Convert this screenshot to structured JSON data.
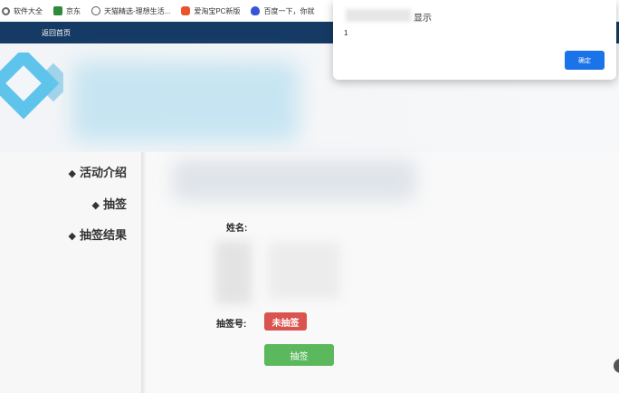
{
  "bookmarks": [
    {
      "label": "软件大全",
      "icon": "gear-icon"
    },
    {
      "label": "京东",
      "icon": "jd-icon"
    },
    {
      "label": "天猫精选-理想生活...",
      "icon": "globe-icon"
    },
    {
      "label": "爱淘宝PC新版",
      "icon": "taobao-icon"
    },
    {
      "label": "百度一下，你就",
      "icon": "baidu-icon"
    }
  ],
  "topnav": {
    "home_label": "返回首页"
  },
  "sidebar": {
    "items": [
      {
        "label": "活动介绍"
      },
      {
        "label": "抽签"
      },
      {
        "label": "抽签结果"
      }
    ],
    "bullet": "◆"
  },
  "form": {
    "name_label": "姓名:",
    "number_label": "抽签号:",
    "status_badge": "未抽签",
    "draw_button": "抽签"
  },
  "dialog": {
    "title": "显示",
    "message": "1",
    "ok_label": "确定"
  },
  "colors": {
    "nav": "#153a63",
    "badge": "#d9534f",
    "button": "#5cb85c",
    "ok": "#1a73e8",
    "logo": "#5fc4ec"
  }
}
